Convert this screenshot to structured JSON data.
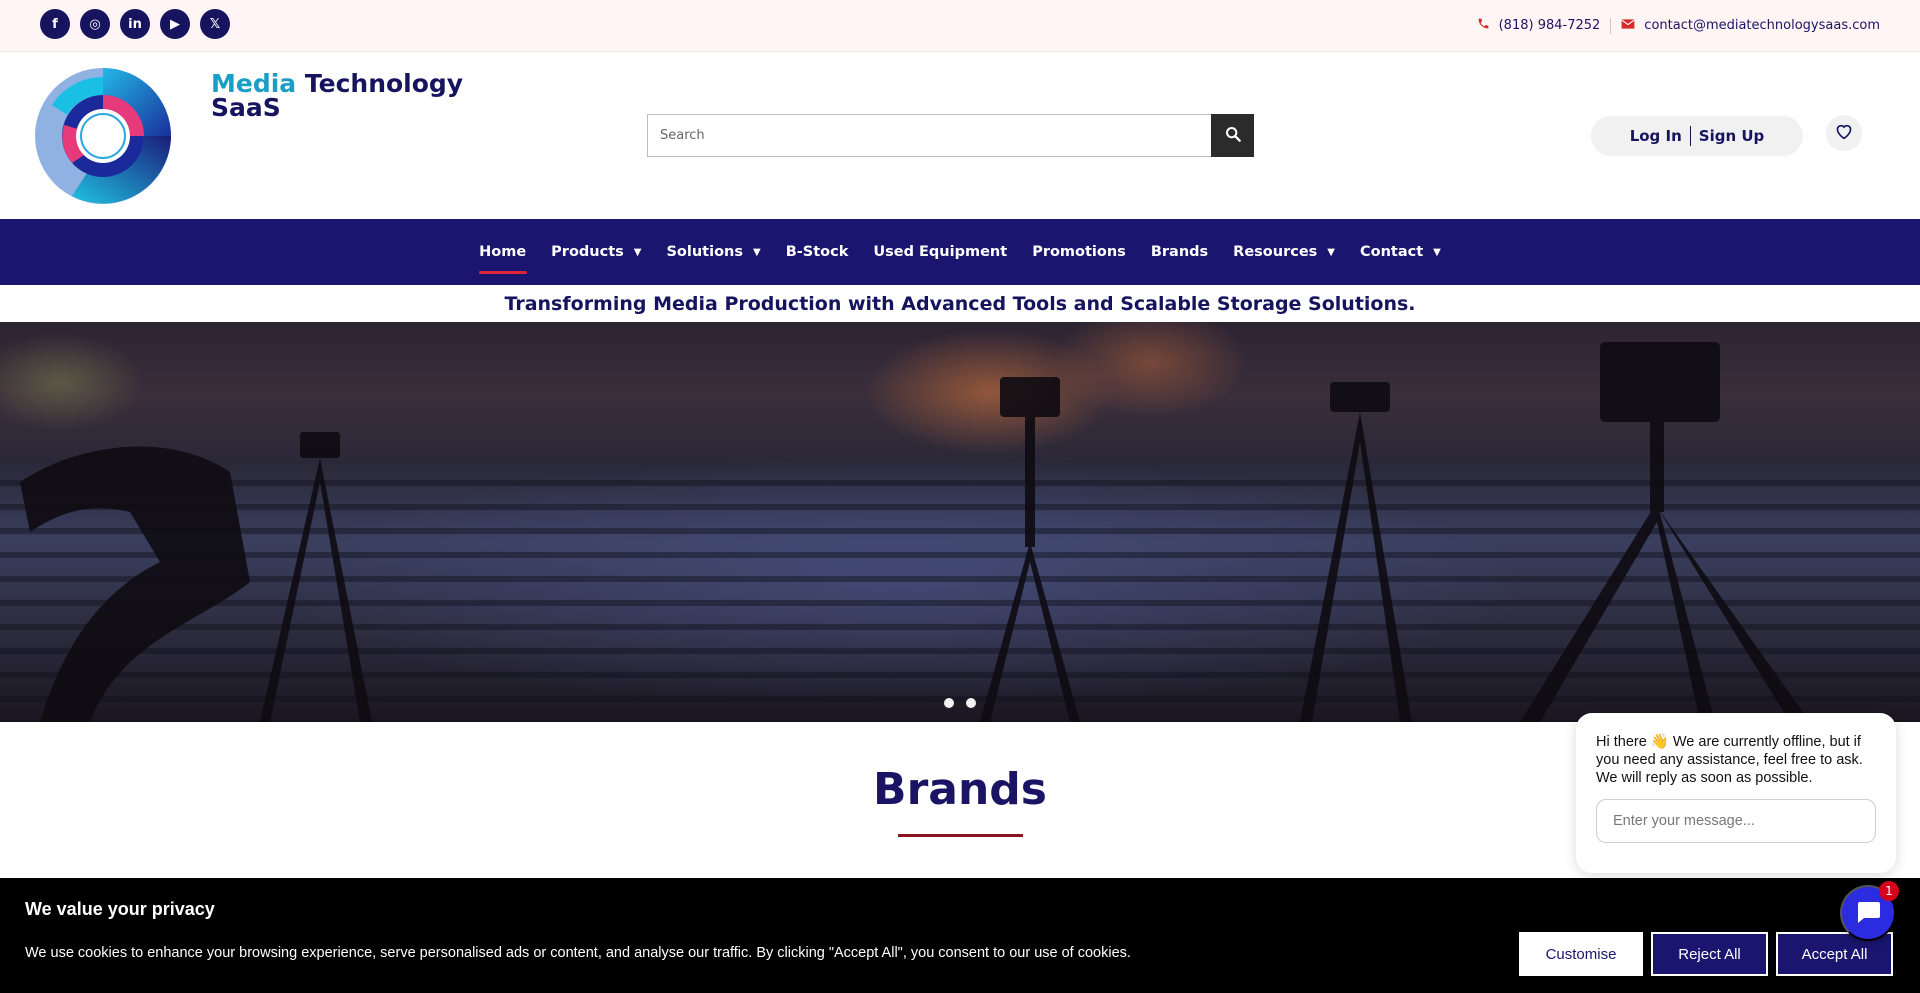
{
  "topbar": {
    "social": [
      {
        "name": "facebook-icon",
        "glyph": "f"
      },
      {
        "name": "instagram-icon",
        "glyph": "◎"
      },
      {
        "name": "linkedin-icon",
        "glyph": "in"
      },
      {
        "name": "youtube-icon",
        "glyph": "▶"
      },
      {
        "name": "x-icon",
        "glyph": "𝕏"
      }
    ],
    "phone": "(818) 984-7252",
    "email": "contact@mediatechnologysaas.com"
  },
  "header": {
    "brand_word1": "Media",
    "brand_word2": "Technology",
    "brand_word3": "SaaS",
    "search_placeholder": "Search",
    "login_label": "Log In",
    "signup_label": "Sign Up"
  },
  "nav": {
    "items": [
      {
        "label": "Home",
        "active": true,
        "dropdown": false
      },
      {
        "label": "Products",
        "active": false,
        "dropdown": true
      },
      {
        "label": "Solutions",
        "active": false,
        "dropdown": true
      },
      {
        "label": "B-Stock",
        "active": false,
        "dropdown": false
      },
      {
        "label": "Used Equipment",
        "active": false,
        "dropdown": false
      },
      {
        "label": "Promotions",
        "active": false,
        "dropdown": false
      },
      {
        "label": "Brands",
        "active": false,
        "dropdown": false
      },
      {
        "label": "Resources",
        "active": false,
        "dropdown": true
      },
      {
        "label": "Contact",
        "active": false,
        "dropdown": true
      }
    ]
  },
  "tagline": "Transforming Media Production with Advanced Tools and Scalable Storage Solutions.",
  "hero": {
    "slides": 2,
    "current_slide": 1
  },
  "brands": {
    "title": "Brands"
  },
  "chat": {
    "message": "Hi there 👋 We are currently offline, but if you need any assistance, feel free to ask. We will reply as soon as possible.",
    "input_placeholder": "Enter your message...",
    "badge_count": "1"
  },
  "cookie": {
    "title": "We value your privacy",
    "text": "We use cookies to enhance your browsing experience, serve personalised ads or content, and analyse our traffic. By clicking \"Accept All\", you consent to our use of cookies.",
    "customise_label": "Customise",
    "reject_label": "Reject All",
    "accept_label": "Accept All"
  },
  "colors": {
    "primary": "#1a1670",
    "accent": "#e02438",
    "brand_cyan": "#1a9dc6",
    "topbar_bg": "#fff5f5"
  }
}
